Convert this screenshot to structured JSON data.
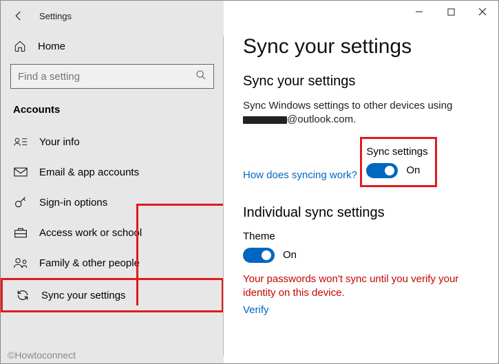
{
  "window_title": "Settings",
  "sidebar": {
    "home_label": "Home",
    "search_placeholder": "Find a setting",
    "section": "Accounts",
    "items": [
      {
        "label": "Your info"
      },
      {
        "label": "Email & app accounts"
      },
      {
        "label": "Sign-in options"
      },
      {
        "label": "Access work or school"
      },
      {
        "label": "Family & other people"
      },
      {
        "label": "Sync your settings"
      }
    ]
  },
  "main": {
    "page_title": "Sync your settings",
    "section1_heading": "Sync your settings",
    "sync_desc_prefix": "Sync Windows settings to other devices using",
    "sync_email_suffix": "@outlook.com.",
    "help_link": "How does syncing work?",
    "sync_toggle_label": "Sync settings",
    "sync_toggle_state": "On",
    "section2_heading": "Individual sync settings",
    "theme_label": "Theme",
    "theme_state": "On",
    "warning": "Your passwords won't sync until you verify your identity on this device.",
    "verify_link": "Verify"
  },
  "watermark": "©Howtoconnect"
}
